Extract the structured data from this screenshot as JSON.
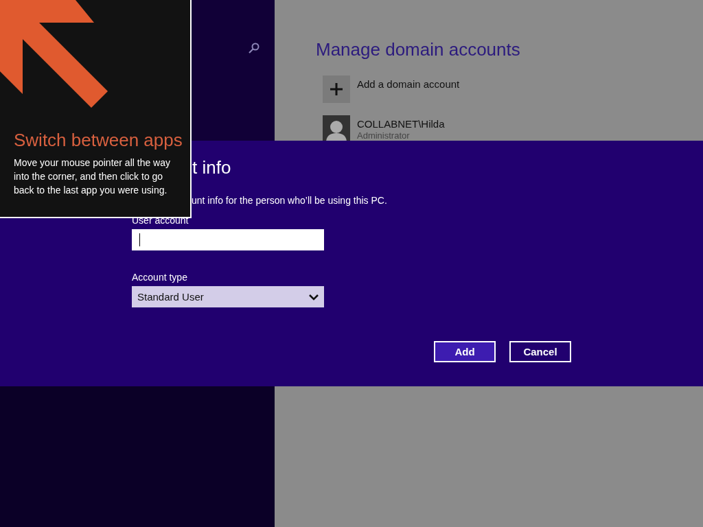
{
  "tooltip": {
    "title": "Switch between apps",
    "body": "Move your mouse pointer all the way into the corner, and then click to go back to the last app you were using."
  },
  "background": {
    "title": "Manage domain accounts",
    "items": [
      {
        "kind": "add",
        "label": "Add a domain account"
      },
      {
        "kind": "user",
        "label": "COLLABNET\\Hilda",
        "subtitle": "Administrator"
      }
    ]
  },
  "dialog": {
    "title": "t info",
    "description": "unt info for the person who’ll be using this PC.",
    "fields": [
      {
        "kind": "text",
        "label": "User account",
        "focused": true
      },
      {
        "kind": "select",
        "label": "Account type",
        "value": "Standard User"
      }
    ],
    "buttons": [
      {
        "label": "Add",
        "primary": true
      },
      {
        "label": "Cancel",
        "primary": false
      }
    ]
  }
}
